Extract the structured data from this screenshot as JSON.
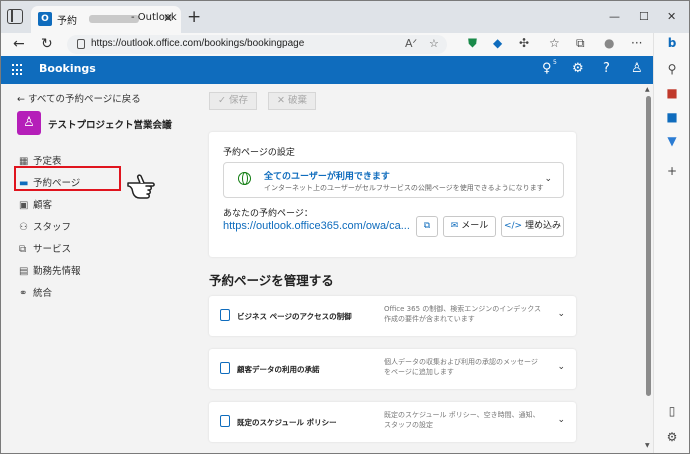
{
  "browser": {
    "tab_title_prefix": "予約",
    "tab_title_suffix": "- Outlook",
    "url": "https://outlook.office.com/bookings/bookingpage"
  },
  "app": {
    "name": "Bookings",
    "notification_count": "5"
  },
  "leftnav": {
    "back_label": "すべての予約ページに戻る",
    "avatar_initial": "",
    "business_name": "テストプロジェクト営業会議",
    "items": [
      {
        "label": "予定表",
        "icon": "calendar-icon"
      },
      {
        "label": "予約ページ",
        "icon": "booking-page-icon"
      },
      {
        "label": "顧客",
        "icon": "customers-icon"
      },
      {
        "label": "スタッフ",
        "icon": "staff-icon"
      },
      {
        "label": "サービス",
        "icon": "services-icon"
      },
      {
        "label": "勤務先情報",
        "icon": "business-info-icon"
      },
      {
        "label": "統合",
        "icon": "integrations-icon"
      }
    ]
  },
  "commands": {
    "save_label": "保存",
    "discard_label": "破棄"
  },
  "settings_card": {
    "title": "予約ページの設定",
    "visibility_title": "全てのユーザーが利用できます",
    "visibility_desc": "インターネット上のユーザーがセルフサービスの公開ページを使用できるようになります",
    "page_label": "あなたの予約ページ：",
    "page_url": "https://outlook.office365.com/owa/ca...",
    "email_label": "メール",
    "embed_label": "埋め込み"
  },
  "manage": {
    "heading": "予約ページを管理する",
    "items": [
      {
        "title": "ビジネス ページのアクセスの制御",
        "desc": "Office 365 の制御、検索エンジンのインデックス作成の要件が含まれています"
      },
      {
        "title": "顧客データの利用の承諾",
        "desc": "個人データの収集および利用の承認のメッセージをページに追加します"
      },
      {
        "title": "既定のスケジュール ポリシー",
        "desc": "既定のスケジュール ポリシー、空き時間、通知、スタッフの設定"
      }
    ]
  },
  "colors": {
    "accent": "#0f6cbd",
    "highlight": "#e0141e",
    "avatar": "#b51fb9"
  }
}
